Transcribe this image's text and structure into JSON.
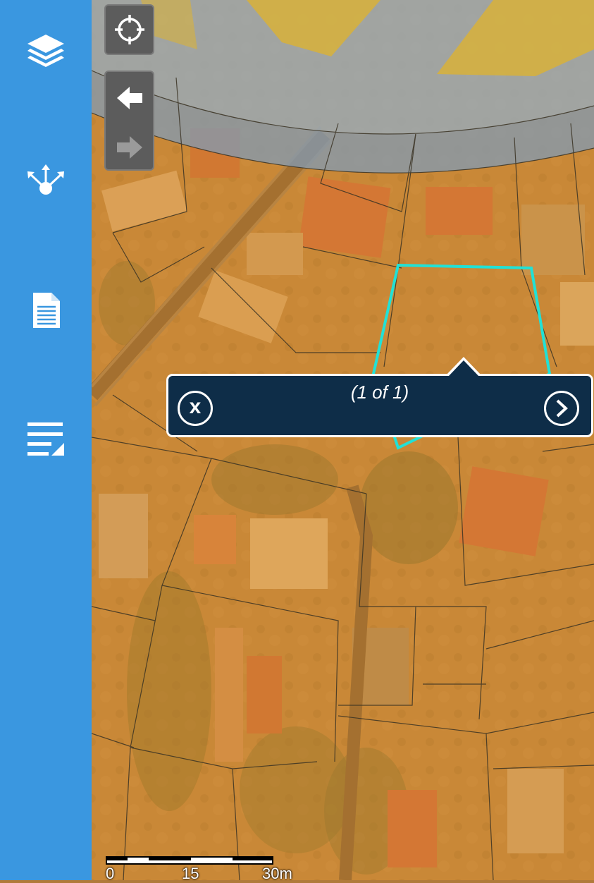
{
  "sidebar": {
    "items": [
      {
        "icon": "layers-icon"
      },
      {
        "icon": "share-network-icon"
      },
      {
        "icon": "document-icon"
      },
      {
        "icon": "list-edit-icon"
      }
    ]
  },
  "map": {
    "controls": [
      "locate-icon",
      "back-arrow-icon",
      "forward-arrow-icon"
    ],
    "overlay_color": "#e8952a",
    "selection_color": "#21e1d6"
  },
  "popup": {
    "count": "(1 of 1)",
    "close_label": "x",
    "next_label": "›"
  },
  "scale": {
    "labels": [
      "0",
      "15",
      "30m"
    ]
  }
}
